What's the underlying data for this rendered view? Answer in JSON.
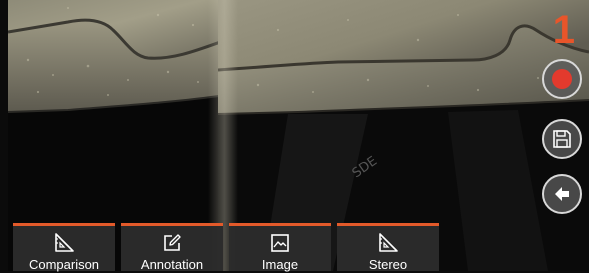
{
  "screen_indicator": "1",
  "side_controls": [
    {
      "icon": "record-icon",
      "color": "#e33a2d"
    },
    {
      "icon": "save-icon"
    },
    {
      "icon": "back-arrow-icon"
    }
  ],
  "toolbar": {
    "accent_color": "#e35a2a",
    "items": [
      {
        "label": "Comparison",
        "icon": "measure-triangle-icon"
      },
      {
        "label": "Annotation",
        "icon": "edit-pencil-icon"
      },
      {
        "label": "Image",
        "icon": "image-icon"
      },
      {
        "label": "Stereo",
        "icon": "stereo-measure-icon"
      }
    ]
  },
  "view": {
    "stamped_text": "SDE"
  }
}
